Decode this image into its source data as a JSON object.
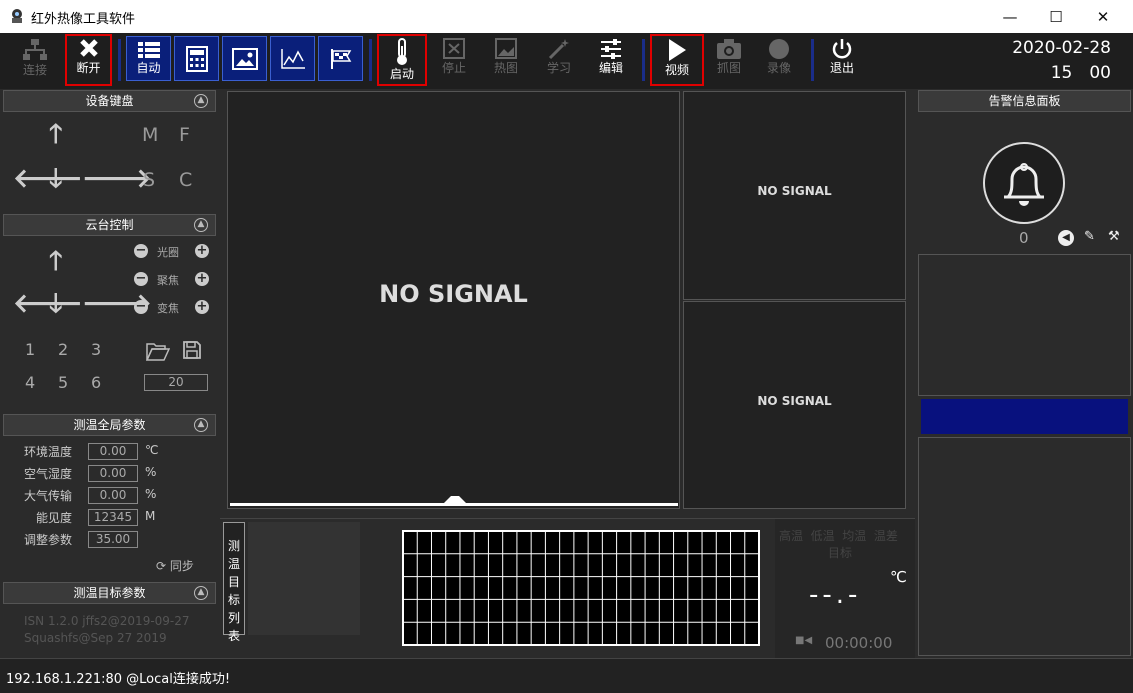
{
  "window": {
    "title": "红外热像工具软件",
    "minimize": "—",
    "maximize": "☐",
    "close": "✕"
  },
  "toolbar": {
    "connect": "连接",
    "disconnect": "断开",
    "auto": "自动",
    "start": "启动",
    "stop": "停止",
    "thermal": "热图",
    "learn": "学习",
    "edit": "编辑",
    "video": "视频",
    "capture": "抓图",
    "record": "录像",
    "exit": "退出"
  },
  "datetime": {
    "date": "2020-02-28",
    "time": "15　00"
  },
  "device_keyboard": {
    "title": "设备键盘",
    "m": "M",
    "f": "F",
    "s": "S",
    "c": "C"
  },
  "ptz": {
    "title": "云台控制",
    "iris": "光圈",
    "focus": "聚焦",
    "zoom": "变焦",
    "presets": [
      "1",
      "2",
      "3",
      "4",
      "5",
      "6"
    ],
    "speed": "20"
  },
  "global_params": {
    "title": "测温全局参数",
    "rows": [
      {
        "label": "环境温度",
        "value": "0.00",
        "unit": "℃"
      },
      {
        "label": "空气湿度",
        "value": "0.00",
        "unit": "%"
      },
      {
        "label": "大气传输",
        "value": "0.00",
        "unit": "%"
      },
      {
        "label": "能见度",
        "value": "12345",
        "unit": "M"
      },
      {
        "label": "调整参数",
        "value": "35.00",
        "unit": ""
      }
    ],
    "sync": "同步"
  },
  "target_params": {
    "title": "测温目标参数",
    "isn": "ISN 1.2.0 jffs2@2019-09-27",
    "fs": "Squashfs@Sep 27 2019"
  },
  "video": {
    "main": "NO SIGNAL",
    "sub1": "NO SIGNAL",
    "sub2": "NO SIGNAL"
  },
  "target_list": {
    "label": "测温目标列表"
  },
  "readout": {
    "headers": "高温  低温  均温  温差",
    "sub": "目标",
    "unit": "℃",
    "value": "--.-",
    "time": "00:00:00"
  },
  "alarm": {
    "title": "告警信息面板",
    "count": "0"
  },
  "status": {
    "text": "192.168.1.221:80 @Local连接成功!"
  }
}
